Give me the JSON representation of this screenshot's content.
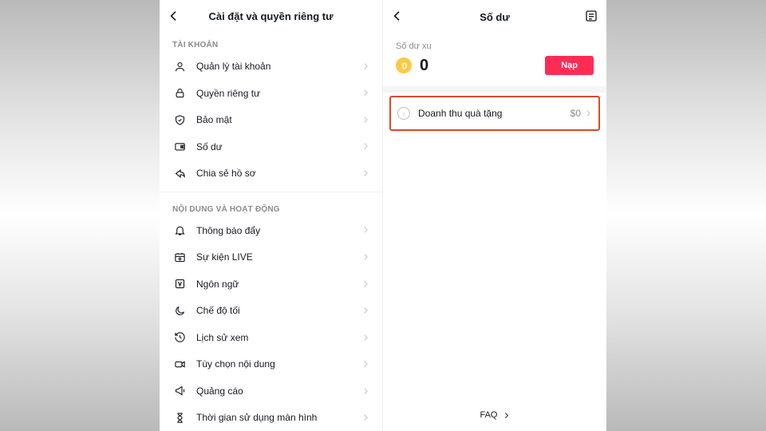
{
  "left": {
    "title": "Cài đặt và quyền riêng tư",
    "section_account": "TÀI KHOẢN",
    "items_account": [
      {
        "label": "Quản lý tài khoản",
        "icon": "user"
      },
      {
        "label": "Quyền riêng tư",
        "icon": "lock"
      },
      {
        "label": "Bảo mật",
        "icon": "shield"
      },
      {
        "label": "Số dư",
        "icon": "wallet"
      },
      {
        "label": "Chia sẻ hồ sơ",
        "icon": "share"
      }
    ],
    "section_content": "NỘI DUNG VÀ HOẠT ĐỘNG",
    "items_content": [
      {
        "label": "Thông báo đẩy",
        "icon": "bell"
      },
      {
        "label": "Sự kiện LIVE",
        "icon": "live"
      },
      {
        "label": "Ngôn ngữ",
        "icon": "lang"
      },
      {
        "label": "Chế độ tối",
        "icon": "dark"
      },
      {
        "label": "Lịch sử xem",
        "icon": "history"
      },
      {
        "label": "Tùy chọn nội dung",
        "icon": "video"
      },
      {
        "label": "Quảng cáo",
        "icon": "ads"
      },
      {
        "label": "Thời gian sử dụng màn hình",
        "icon": "screentime"
      }
    ]
  },
  "right": {
    "title": "Số dư",
    "coin_label": "Số dư xu",
    "coin_value": "0",
    "topup": "Nạp",
    "gift_label": "Doanh thu quà tặng",
    "gift_value": "$0",
    "faq": "FAQ"
  },
  "colors": {
    "accent": "#fe2c55",
    "highlight": "#d94a2b",
    "coin": "#fec945"
  }
}
